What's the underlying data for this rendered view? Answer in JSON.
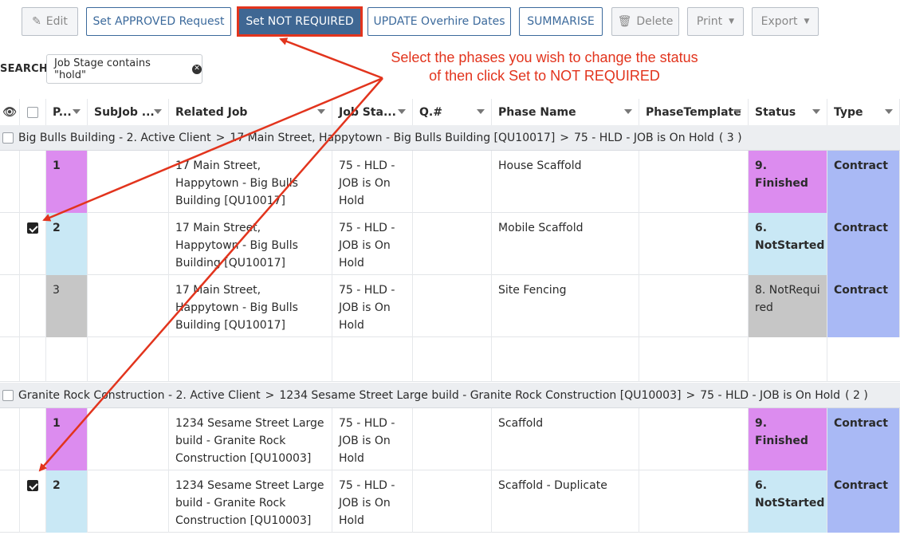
{
  "toolbar": {
    "edit": "Edit",
    "set_approved": "Set APPROVED Request",
    "set_not_required": "Set NOT REQUIRED",
    "update_overhire": "UPDATE Overhire Dates",
    "summarise": "SUMMARISE",
    "delete": "Delete",
    "print": "Print",
    "export": "Export"
  },
  "search": {
    "label": "SEARCH",
    "chip": "Job Stage contains \"hold\""
  },
  "annotation": {
    "line1": "Select the phases you wish to change the status",
    "line2": "of then click Set to NOT REQUIRED",
    "color": "#e2341d"
  },
  "columns": [
    "P...",
    "SubJob ...",
    "Related Job",
    "Job Sta...",
    "Q.#",
    "Phase Name",
    "PhaseTemplate",
    "Status",
    "Type"
  ],
  "colors": {
    "finished": "#dc8cef",
    "not_started": "#c9e8f5",
    "not_required": "#c6c6c6",
    "contract": "#a9b9f5",
    "button_active": "#3f6793"
  },
  "groups": [
    {
      "client": "Big Bulls Building - 2. Active Client",
      "job": "17 Main Street, Happytown - Big Bulls Building [QU10017]",
      "stage": "75 - HLD - JOB is On Hold",
      "count": "( 3 )",
      "rows": [
        {
          "p": "1",
          "related": "17 Main Street, Happytown - Big Bulls Building [QU10017]",
          "stage": "75 - HLD - JOB is On Hold",
          "phase": "House Scaffold",
          "status": "9. Finished",
          "type": "Contract",
          "checked": false
        },
        {
          "p": "2",
          "related": "17 Main Street, Happytown - Big Bulls Building [QU10017]",
          "stage": "75 - HLD - JOB is On Hold",
          "phase": "Mobile Scaffold",
          "status": "6. NotStarted",
          "type": "Contract",
          "checked": true
        },
        {
          "p": "3",
          "related": "17 Main Street, Happytown - Big Bulls Building [QU10017]",
          "stage": "75 - HLD - JOB is On Hold",
          "phase": "Site Fencing",
          "status": "8. NotRequired",
          "type": "Contract",
          "checked": false
        }
      ]
    },
    {
      "client": "Granite Rock Construction - 2. Active Client",
      "job": "1234 Sesame Street Large build - Granite Rock Construction [QU10003]",
      "stage": "75 - HLD - JOB is On Hold",
      "count": "( 2 )",
      "rows": [
        {
          "p": "1",
          "related": "1234 Sesame Street Large build - Granite Rock Construction [QU10003]",
          "stage": "75 - HLD - JOB is On Hold",
          "phase": "Scaffold",
          "status": "9. Finished",
          "type": "Contract",
          "checked": false
        },
        {
          "p": "2",
          "related": "1234 Sesame Street Large build - Granite Rock Construction [QU10003]",
          "stage": "75 - HLD - JOB is On Hold",
          "phase": "Scaffold - Duplicate",
          "status": "6. NotStarted",
          "type": "Contract",
          "checked": true
        }
      ]
    }
  ]
}
